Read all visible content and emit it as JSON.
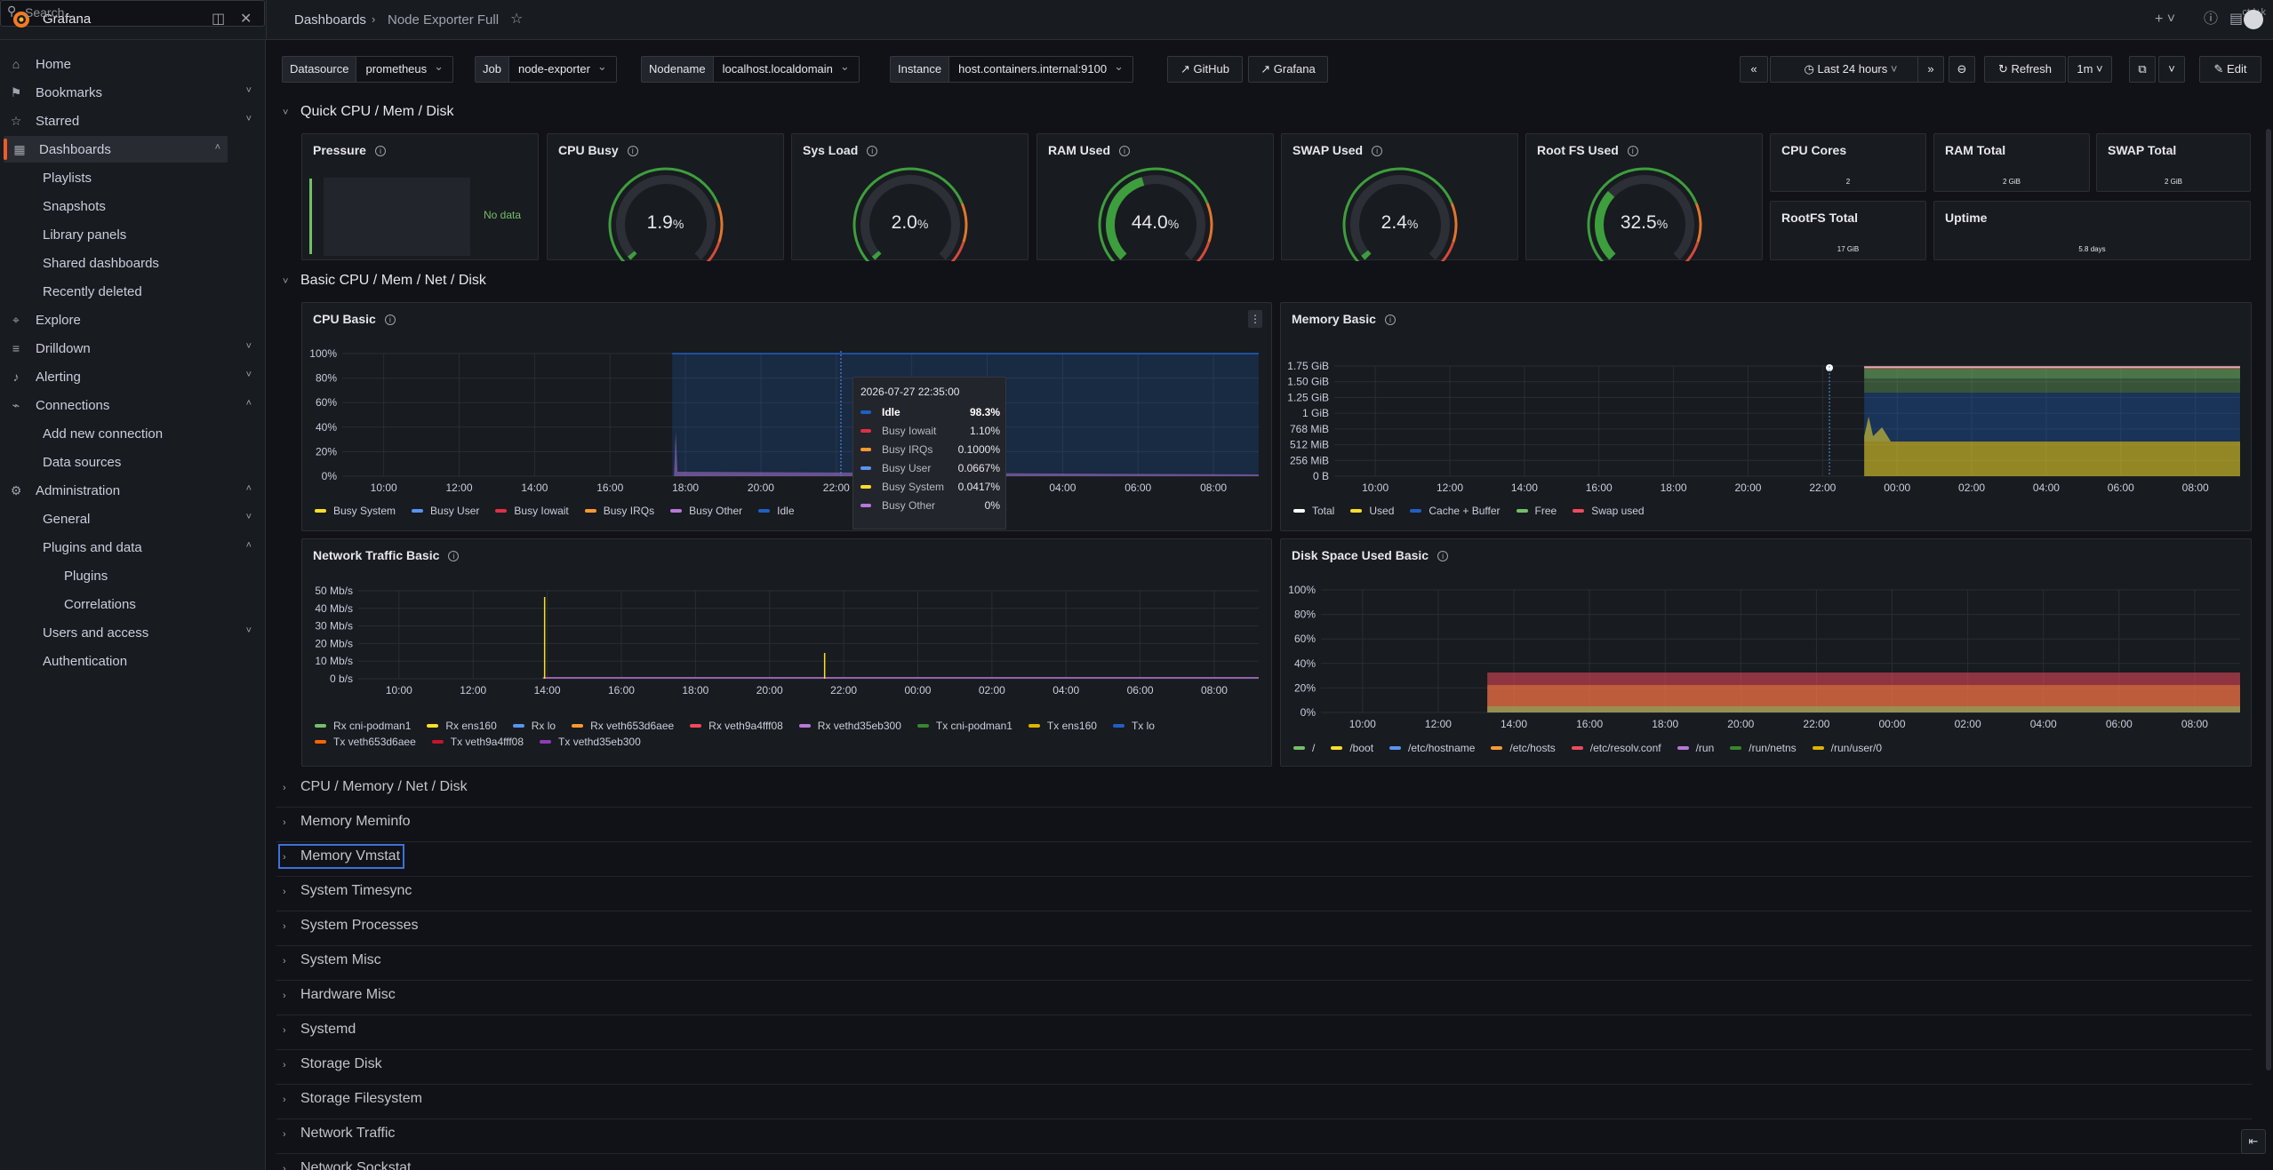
{
  "topbar": {
    "brand": "Grafana",
    "breadcrumb": [
      "Dashboards",
      "Node Exporter Full"
    ],
    "search_placeholder": "Search...",
    "search_shortcut": "ctrl+k"
  },
  "sidebar": {
    "items": [
      {
        "label": "Home",
        "icon": "home-icon",
        "level": 0
      },
      {
        "label": "Bookmarks",
        "icon": "bookmark-icon",
        "level": 0,
        "chev": "down"
      },
      {
        "label": "Starred",
        "icon": "star-icon",
        "level": 0,
        "chev": "down"
      },
      {
        "label": "Dashboards",
        "icon": "dashboards-icon",
        "level": 0,
        "chev": "up",
        "active": true
      },
      {
        "label": "Playlists",
        "level": 1
      },
      {
        "label": "Snapshots",
        "level": 1
      },
      {
        "label": "Library panels",
        "level": 1
      },
      {
        "label": "Shared dashboards",
        "level": 1
      },
      {
        "label": "Recently deleted",
        "level": 1
      },
      {
        "label": "Explore",
        "icon": "compass-icon",
        "level": 0
      },
      {
        "label": "Drilldown",
        "icon": "drilldown-icon",
        "level": 0,
        "chev": "down"
      },
      {
        "label": "Alerting",
        "icon": "bell-icon",
        "level": 0,
        "chev": "down"
      },
      {
        "label": "Connections",
        "icon": "plug-icon",
        "level": 0,
        "chev": "up"
      },
      {
        "label": "Add new connection",
        "level": 1
      },
      {
        "label": "Data sources",
        "level": 1
      },
      {
        "label": "Administration",
        "icon": "gear-icon",
        "level": 0,
        "chev": "up"
      },
      {
        "label": "General",
        "level": 1,
        "chev": "down"
      },
      {
        "label": "Plugins and data",
        "level": 1,
        "chev": "up"
      },
      {
        "label": "Plugins",
        "level": 2
      },
      {
        "label": "Correlations",
        "level": 2
      },
      {
        "label": "Users and access",
        "level": 1,
        "chev": "down"
      },
      {
        "label": "Authentication",
        "level": 1
      }
    ]
  },
  "variables": {
    "datasource": {
      "key": "Datasource",
      "value": "prometheus"
    },
    "job": {
      "key": "Job",
      "value": "node-exporter"
    },
    "nodename": {
      "key": "Nodename",
      "value": "localhost.localdomain"
    },
    "instance": {
      "key": "Instance",
      "value": "host.containers.internal:9100"
    },
    "links": [
      "GitHub",
      "Grafana"
    ]
  },
  "toolbar": {
    "time_range": "Last 24 hours",
    "refresh": "Refresh",
    "interval": "1m",
    "edit": "Edit"
  },
  "rows": {
    "quick": "Quick CPU / Mem / Disk",
    "basic": "Basic CPU / Mem / Net / Disk",
    "collapsed": [
      "CPU / Memory / Net / Disk",
      "Memory Meminfo",
      "Memory Vmstat",
      "System Timesync",
      "System Processes",
      "System Misc",
      "Hardware Misc",
      "Systemd",
      "Storage Disk",
      "Storage Filesystem",
      "Network Traffic",
      "Network Sockstat"
    ]
  },
  "quick_panels": {
    "pressure": {
      "title": "Pressure",
      "nodata": "No data"
    },
    "gauges": [
      {
        "title": "CPU Busy",
        "value": "1.9",
        "unit": "%",
        "pct": 1.9,
        "color": "#3d9e3d"
      },
      {
        "title": "Sys Load",
        "value": "2.0",
        "unit": "%",
        "pct": 2.0,
        "color": "#3d9e3d"
      },
      {
        "title": "RAM Used",
        "value": "44.0",
        "unit": "%",
        "pct": 44.0,
        "color": "#3d9e3d"
      },
      {
        "title": "SWAP Used",
        "value": "2.4",
        "unit": "%",
        "pct": 2.4,
        "color": "#3d9e3d"
      },
      {
        "title": "Root FS Used",
        "value": "32.5",
        "unit": "%",
        "pct": 32.5,
        "color": "#3d9e3d"
      }
    ],
    "stats": [
      {
        "title": "CPU Cores",
        "value": "2"
      },
      {
        "title": "RAM Total",
        "value": "2 GiB"
      },
      {
        "title": "SWAP Total",
        "value": "2 GiB"
      },
      {
        "title": "RootFS Total",
        "value": "17 GiB"
      },
      {
        "title": "Uptime",
        "value": "5.8 days"
      }
    ]
  },
  "colors": {
    "green": "#73bf69",
    "yellow": "#fade2a",
    "blue": "#5794f2",
    "orange": "#ff9830",
    "red": "#f2495c",
    "purple": "#b877d9",
    "accent": "#f05a28"
  },
  "chart_data": [
    {
      "type": "area",
      "title": "CPU Basic",
      "y_ticks": [
        "100%",
        "80%",
        "60%",
        "40%",
        "20%",
        "0%"
      ],
      "x_ticks": [
        "10:00",
        "12:00",
        "14:00",
        "16:00",
        "18:00",
        "20:00",
        "22:00",
        "00:00",
        "02:00",
        "04:00",
        "06:00",
        "08:00"
      ],
      "series": [
        {
          "name": "Busy System",
          "color": "#fade2a"
        },
        {
          "name": "Busy User",
          "color": "#5794f2"
        },
        {
          "name": "Busy Iowait",
          "color": "#e02f44"
        },
        {
          "name": "Busy IRQs",
          "color": "#ff9830"
        },
        {
          "name": "Busy Other",
          "color": "#b877d9"
        },
        {
          "name": "Idle",
          "color": "#1f60c4"
        }
      ],
      "tooltip": {
        "time": "2026-07-27 22:35:00",
        "rows": [
          {
            "name": "Idle",
            "value": "98.3%",
            "color": "#1f60c4",
            "bold": true
          },
          {
            "name": "Busy Iowait",
            "value": "1.10%",
            "color": "#e02f44"
          },
          {
            "name": "Busy IRQs",
            "value": "0.1000%",
            "color": "#ff9830"
          },
          {
            "name": "Busy User",
            "value": "0.0667%",
            "color": "#5794f2"
          },
          {
            "name": "Busy System",
            "value": "0.0417%",
            "color": "#fade2a"
          },
          {
            "name": "Busy Other",
            "value": "0%",
            "color": "#b877d9"
          }
        ]
      }
    },
    {
      "type": "area",
      "title": "Memory Basic",
      "y_ticks": [
        "1.75 GiB",
        "1.50 GiB",
        "1.25 GiB",
        "1 GiB",
        "768 MiB",
        "512 MiB",
        "256 MiB",
        "0 B"
      ],
      "x_ticks": [
        "10:00",
        "12:00",
        "14:00",
        "16:00",
        "18:00",
        "20:00",
        "22:00",
        "00:00",
        "02:00",
        "04:00",
        "06:00",
        "08:00"
      ],
      "series": [
        {
          "name": "Total",
          "color": "#ffffff"
        },
        {
          "name": "Used",
          "color": "#fade2a"
        },
        {
          "name": "Cache + Buffer",
          "color": "#1f60c4"
        },
        {
          "name": "Free",
          "color": "#73bf69"
        },
        {
          "name": "Swap used",
          "color": "#f2495c"
        }
      ]
    },
    {
      "type": "line",
      "title": "Network Traffic Basic",
      "y_ticks": [
        "50 Mb/s",
        "40 Mb/s",
        "30 Mb/s",
        "20 Mb/s",
        "10 Mb/s",
        "0 b/s"
      ],
      "x_ticks": [
        "10:00",
        "12:00",
        "14:00",
        "16:00",
        "18:00",
        "20:00",
        "22:00",
        "00:00",
        "02:00",
        "04:00",
        "06:00",
        "08:00"
      ],
      "series": [
        {
          "name": "Rx cni-podman1",
          "color": "#73bf69"
        },
        {
          "name": "Rx ens160",
          "color": "#fade2a"
        },
        {
          "name": "Rx lo",
          "color": "#5794f2"
        },
        {
          "name": "Rx veth653d6aee",
          "color": "#ff9830"
        },
        {
          "name": "Rx veth9a4fff08",
          "color": "#f2495c"
        },
        {
          "name": "Rx vethd35eb300",
          "color": "#b877d9"
        },
        {
          "name": "Tx cni-podman1",
          "color": "#37872d"
        },
        {
          "name": "Tx ens160",
          "color": "#e0b400"
        },
        {
          "name": "Tx lo",
          "color": "#1f60c4"
        },
        {
          "name": "Tx veth653d6aee",
          "color": "#fa6400"
        },
        {
          "name": "Tx veth9a4fff08",
          "color": "#c4162a"
        },
        {
          "name": "Tx vethd35eb300",
          "color": "#8f3bb8"
        }
      ]
    },
    {
      "type": "area",
      "title": "Disk Space Used Basic",
      "y_ticks": [
        "100%",
        "80%",
        "60%",
        "40%",
        "20%",
        "0%"
      ],
      "x_ticks": [
        "10:00",
        "12:00",
        "14:00",
        "16:00",
        "18:00",
        "20:00",
        "22:00",
        "00:00",
        "02:00",
        "04:00",
        "06:00",
        "08:00"
      ],
      "series": [
        {
          "name": "/",
          "color": "#73bf69"
        },
        {
          "name": "/boot",
          "color": "#fade2a"
        },
        {
          "name": "/etc/hostname",
          "color": "#5794f2"
        },
        {
          "name": "/etc/hosts",
          "color": "#ff9830"
        },
        {
          "name": "/etc/resolv.conf",
          "color": "#f2495c"
        },
        {
          "name": "/run",
          "color": "#b877d9"
        },
        {
          "name": "/run/netns",
          "color": "#37872d"
        },
        {
          "name": "/run/user/0",
          "color": "#e0b400"
        }
      ]
    }
  ]
}
